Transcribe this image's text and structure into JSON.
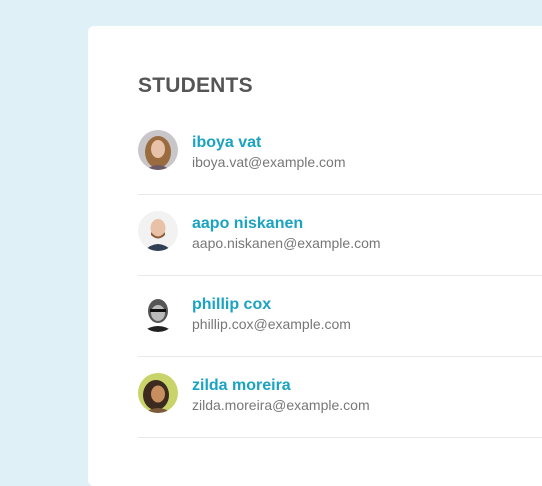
{
  "card": {
    "title": "STUDENTS"
  },
  "students": [
    {
      "name": "iboya vat",
      "email": "iboya.vat@example.com",
      "avatar": "avatar-iboya-vat"
    },
    {
      "name": "aapo niskanen",
      "email": "aapo.niskanen@example.com",
      "avatar": "avatar-aapo-niskanen"
    },
    {
      "name": "phillip cox",
      "email": "phillip.cox@example.com",
      "avatar": "avatar-phillip-cox"
    },
    {
      "name": "zilda moreira",
      "email": "zilda.moreira@example.com",
      "avatar": "avatar-zilda-moreira"
    }
  ],
  "colors": {
    "background": "#dff0f7",
    "card": "#ffffff",
    "title": "#555555",
    "name_link": "#1aa3c2",
    "email": "#777777",
    "divider": "#e8e8e8"
  }
}
